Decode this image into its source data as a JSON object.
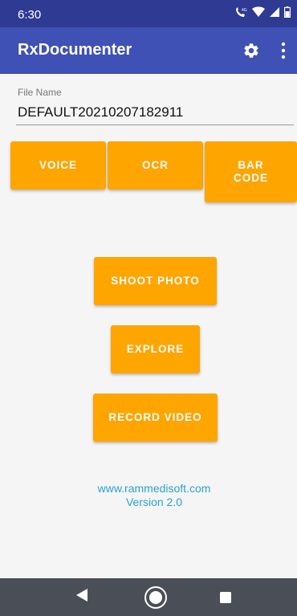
{
  "status_bar": {
    "time": "6:30",
    "icons": [
      "call-4g-icon",
      "wifi-icon",
      "signal-icon",
      "battery-icon"
    ]
  },
  "app_bar": {
    "title": "RxDocumenter",
    "actions": [
      "gear-icon",
      "overflow-menu-icon"
    ]
  },
  "form": {
    "file_name_label": "File Name",
    "file_name_value": "DEFAULT20210207182911"
  },
  "buttons": {
    "voice": "VOICE",
    "ocr": "OCR",
    "barcode": "BAR\nCODE",
    "shoot_photo": "SHOOT PHOTO",
    "explore": "EXPLORE",
    "record_video": "RECORD VIDEO"
  },
  "footer": {
    "url": "www.rammedisoft.com",
    "version": "Version 2.0"
  },
  "nav_bar": {
    "items": [
      "back-icon",
      "home-icon",
      "recents-icon"
    ]
  },
  "colors": {
    "status_bar": "#2f3a93",
    "app_bar": "#3f51b5",
    "button": "#ffa500",
    "link": "#29a3d6",
    "nav_bar": "#4a4f57",
    "background": "#f5f5f5"
  }
}
